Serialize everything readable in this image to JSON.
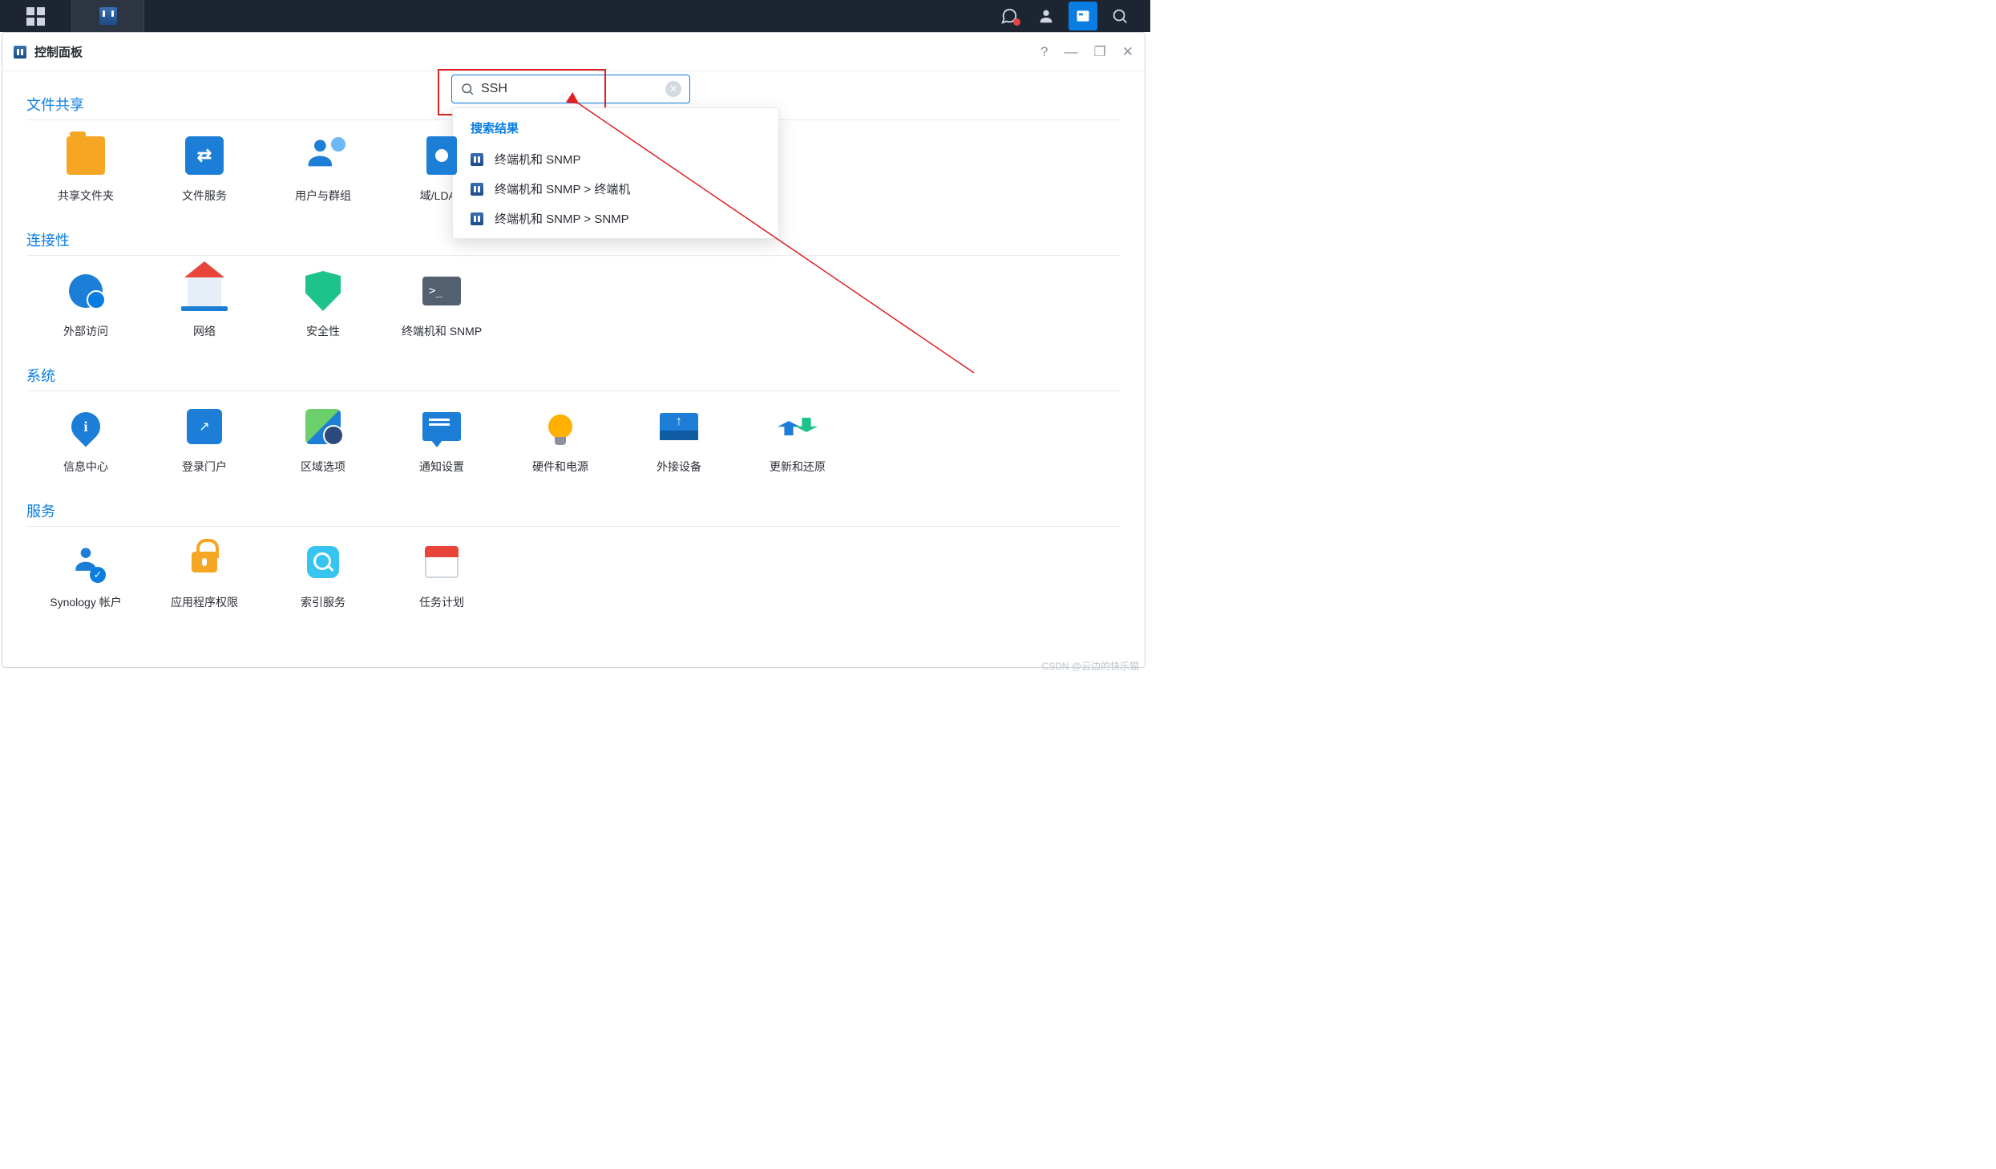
{
  "taskbar": {
    "icons": {
      "apps": "apps-icon",
      "active": "control-panel-icon",
      "chat": "chat-icon",
      "user": "user-icon",
      "widget": "widget-icon",
      "search": "search-icon"
    }
  },
  "window": {
    "title": "控制面板",
    "controls": {
      "help": "?",
      "min": "—",
      "max": "❐",
      "close": "✕"
    }
  },
  "search": {
    "value": "SSH",
    "results_title": "搜索结果",
    "results": [
      "终端机和 SNMP",
      "终端机和 SNMP > 终端机",
      "终端机和 SNMP > SNMP"
    ]
  },
  "sections": [
    {
      "key": "file_sharing",
      "title": "文件共享",
      "items": [
        {
          "key": "shared-folder",
          "label": "共享文件夹",
          "icon": "folder"
        },
        {
          "key": "file-services",
          "label": "文件服务",
          "icon": "file-services"
        },
        {
          "key": "user-group",
          "label": "用户与群组",
          "icon": "user-group"
        },
        {
          "key": "domain-ldap",
          "label": "域/LDAP",
          "icon": "contacts"
        }
      ]
    },
    {
      "key": "connectivity",
      "title": "连接性",
      "items": [
        {
          "key": "external-access",
          "label": "外部访问",
          "icon": "ext-globe"
        },
        {
          "key": "network",
          "label": "网络",
          "icon": "house"
        },
        {
          "key": "security",
          "label": "安全性",
          "icon": "shield"
        },
        {
          "key": "terminal-snmp",
          "label": "终端机和 SNMP",
          "icon": "terminal"
        }
      ]
    },
    {
      "key": "system",
      "title": "系统",
      "items": [
        {
          "key": "info-center",
          "label": "信息中心",
          "icon": "pin"
        },
        {
          "key": "login-portal",
          "label": "登录门户",
          "icon": "portal"
        },
        {
          "key": "regional",
          "label": "区域选项",
          "icon": "globe-clock"
        },
        {
          "key": "notification",
          "label": "通知设置",
          "icon": "msg"
        },
        {
          "key": "hardware-power",
          "label": "硬件和电源",
          "icon": "bulb"
        },
        {
          "key": "external-devices",
          "label": "外接设备",
          "icon": "hdd"
        },
        {
          "key": "update-restore",
          "label": "更新和还原",
          "icon": "sync"
        }
      ]
    },
    {
      "key": "services",
      "title": "服务",
      "items": [
        {
          "key": "synology-account",
          "label": "Synology 帐户",
          "icon": "acct"
        },
        {
          "key": "app-privileges",
          "label": "应用程序权限",
          "icon": "lock"
        },
        {
          "key": "indexing",
          "label": "索引服务",
          "icon": "mag"
        },
        {
          "key": "task-scheduler",
          "label": "任务计划",
          "icon": "cal"
        }
      ]
    }
  ],
  "watermark": "CSDN @云边的快乐猫"
}
